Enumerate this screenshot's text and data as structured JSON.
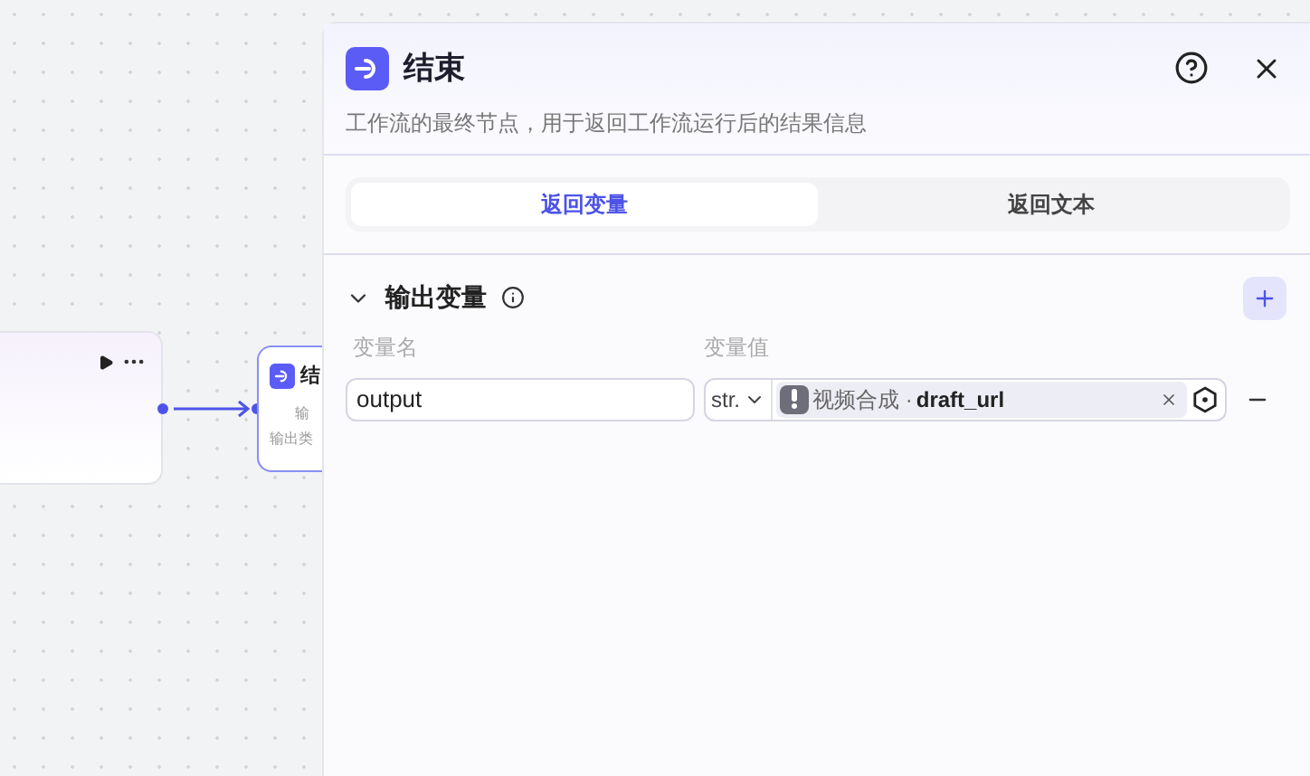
{
  "canvas": {
    "end_node": {
      "title": "结",
      "line_1": "输",
      "line_2": "输出类"
    }
  },
  "panel": {
    "title": "结束",
    "description": "工作流的最终节点，用于返回工作流运行后的结果信息",
    "tabs": [
      {
        "label": "返回变量",
        "selected": true
      },
      {
        "label": "返回文本",
        "selected": false
      }
    ],
    "section": {
      "title": "输出变量",
      "expanded": true,
      "columns": [
        "变量名",
        "变量值"
      ],
      "rows": [
        {
          "name": "output",
          "type": "str.",
          "source": "视频合成",
          "separator": "·",
          "variable": "draft_url"
        }
      ]
    }
  }
}
